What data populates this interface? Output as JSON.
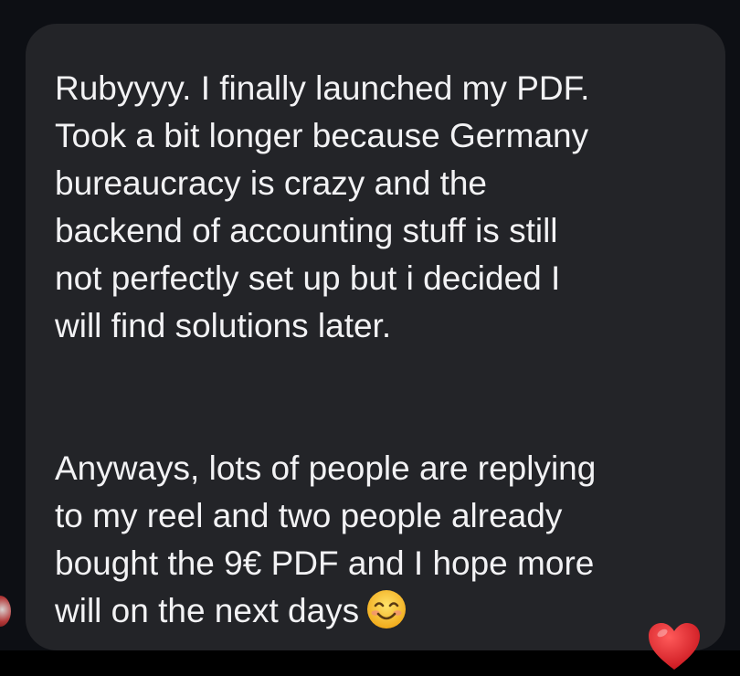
{
  "message": {
    "paragraph1": [
      "Rubyyyy. I finally launched my PDF.",
      "Took a bit longer because Germany",
      "bureaucracy is crazy and the",
      "backend of accounting stuff is still",
      "not perfectly set up but i decided I",
      "will find solutions later."
    ],
    "paragraph2": [
      "Anyways, lots of people are replying",
      "to my reel and two people already",
      "bought the 9€ PDF and I hope more",
      "will on the next days"
    ],
    "trailing_emoji": "smiling-face-with-smiling-eyes",
    "reaction": "heart"
  },
  "colors": {
    "background": "#0d0f14",
    "bubble": "#232428",
    "text": "#f2f2f4",
    "heart": "#e0242b",
    "emoji_face": "#f7c72f"
  }
}
